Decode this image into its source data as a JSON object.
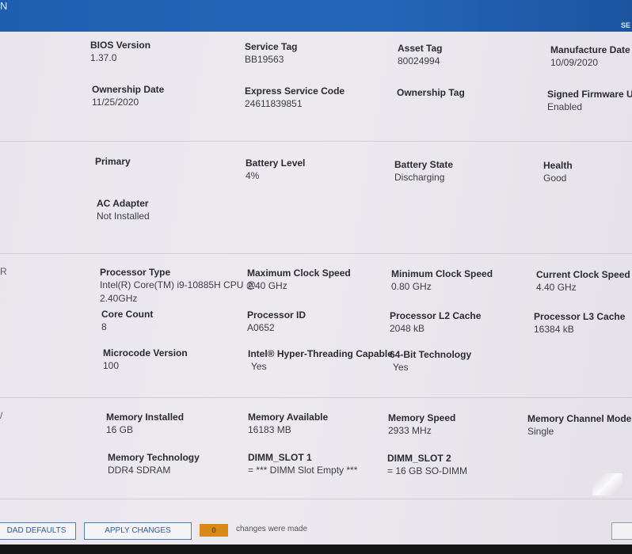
{
  "header": {
    "left_text": "N",
    "right_text": "SE"
  },
  "side_labels": {
    "processor": "R",
    "memory": "/"
  },
  "system": {
    "bios_version": {
      "label": "BIOS Version",
      "value": "1.37.0"
    },
    "service_tag": {
      "label": "Service Tag",
      "value": "BB19563"
    },
    "asset_tag": {
      "label": "Asset Tag",
      "value": "80024994"
    },
    "manufacture_date": {
      "label": "Manufacture Date",
      "value": "10/09/2020"
    },
    "ownership_date": {
      "label": "Ownership Date",
      "value": "11/25/2020"
    },
    "express_service_code": {
      "label": "Express Service Code",
      "value": "24611839851"
    },
    "ownership_tag": {
      "label": "Ownership Tag",
      "value": ""
    },
    "signed_firmware": {
      "label": "Signed Firmware Up",
      "value": "Enabled"
    }
  },
  "battery": {
    "primary": {
      "label": "Primary"
    },
    "battery_level": {
      "label": "Battery Level",
      "value": "4%"
    },
    "battery_state": {
      "label": "Battery State",
      "value": "Discharging"
    },
    "health": {
      "label": "Health",
      "value": "Good"
    },
    "ac_adapter": {
      "label": "AC Adapter",
      "value": "Not Installed"
    }
  },
  "processor": {
    "type": {
      "label": "Processor Type",
      "value_line1": "Intel(R) Core(TM) i9-10885H CPU @",
      "value_line2": "2.40GHz"
    },
    "max_clock": {
      "label": "Maximum Clock Speed",
      "value": "2.40 GHz"
    },
    "min_clock": {
      "label": "Minimum Clock Speed",
      "value": "0.80 GHz"
    },
    "current_clock": {
      "label": "Current Clock Speed",
      "value": "4.40 GHz"
    },
    "core_count": {
      "label": "Core Count",
      "value": "8"
    },
    "processor_id": {
      "label": "Processor ID",
      "value": "A0652"
    },
    "l2_cache": {
      "label": "Processor L2 Cache",
      "value": "2048 kB"
    },
    "l3_cache": {
      "label": "Processor L3 Cache",
      "value": "16384 kB"
    },
    "microcode": {
      "label": "Microcode Version",
      "value": "100"
    },
    "hyper_threading": {
      "label": "Intel® Hyper-Threading Capable",
      "value": "Yes"
    },
    "bit64": {
      "label": "64-Bit Technology",
      "value": "Yes"
    }
  },
  "memory": {
    "installed": {
      "label": "Memory Installed",
      "value": "16 GB"
    },
    "available": {
      "label": "Memory Available",
      "value": "16183 MB"
    },
    "speed": {
      "label": "Memory Speed",
      "value": "2933 MHz"
    },
    "channel_mode": {
      "label": "Memory Channel Mode",
      "value": "Single"
    },
    "technology": {
      "label": "Memory Technology",
      "value": "DDR4 SDRAM"
    },
    "dimm1": {
      "label": "DIMM_SLOT 1",
      "value": "= *** DIMM Slot Empty ***"
    },
    "dimm2": {
      "label": "DIMM_SLOT 2",
      "value": "= 16 GB SO-DIMM"
    }
  },
  "footer": {
    "load_defaults": "DAD DEFAULTS",
    "apply_changes": "APPLY CHANGES",
    "change_count": "0",
    "changes_text": "changes were made"
  },
  "colors": {
    "header_blue": "#2466b8",
    "counter_orange": "#d88a16",
    "button_border": "#4a7fc0"
  }
}
